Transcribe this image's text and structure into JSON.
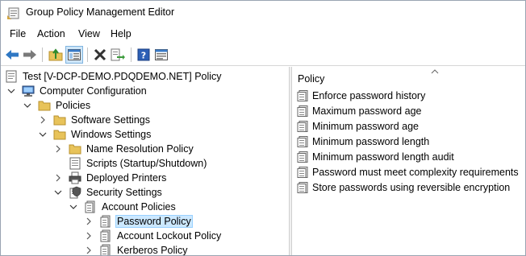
{
  "window": {
    "title": "Group Policy Management Editor"
  },
  "menu": [
    "File",
    "Action",
    "View",
    "Help"
  ],
  "toolbar": {
    "buttons": [
      "back-icon",
      "forward-icon",
      "up-folder-icon",
      "show-hide-tree-icon",
      "delete-icon",
      "export-list-icon",
      "help-icon",
      "properties-icon"
    ]
  },
  "tree": {
    "root": "Test [V-DCP-DEMO.PDQDEMO.NET] Policy",
    "computer_configuration": "Computer Configuration",
    "policies": "Policies",
    "software_settings": "Software Settings",
    "windows_settings": "Windows Settings",
    "name_resolution_policy": "Name Resolution Policy",
    "scripts": "Scripts (Startup/Shutdown)",
    "deployed_printers": "Deployed Printers",
    "security_settings": "Security Settings",
    "account_policies": "Account Policies",
    "password_policy": "Password Policy",
    "account_lockout_policy": "Account Lockout Policy",
    "kerberos_policy": "Kerberos Policy"
  },
  "details": {
    "column_header": "Policy",
    "items": [
      "Enforce password history",
      "Maximum password age",
      "Minimum password age",
      "Minimum password length",
      "Minimum password length audit",
      "Password must meet complexity requirements",
      "Store passwords using reversible encryption"
    ]
  },
  "colors": {
    "selection_bg": "#cce8ff",
    "selection_border": "#99d1ff",
    "folder": "#e8c35a"
  }
}
